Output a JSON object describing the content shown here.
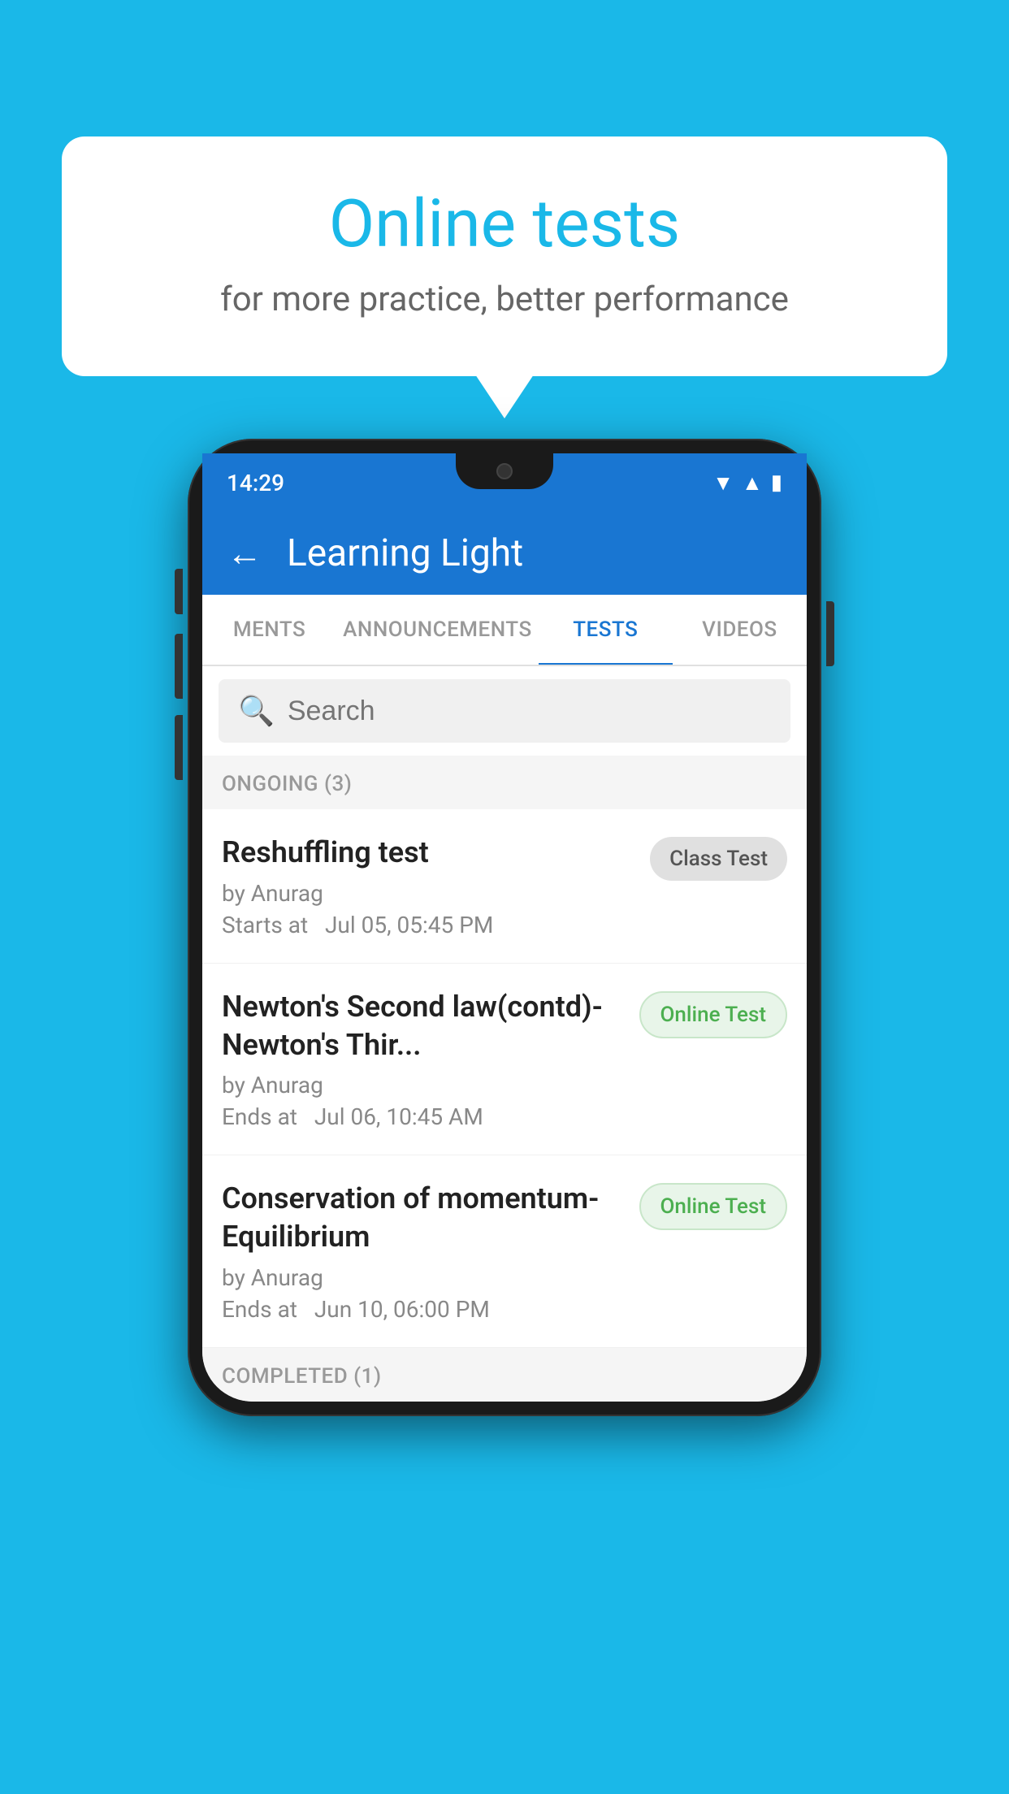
{
  "background": {
    "color": "#1ab8e8"
  },
  "speech_bubble": {
    "title": "Online tests",
    "subtitle": "for more practice, better performance"
  },
  "phone": {
    "status_bar": {
      "time": "14:29",
      "icons": [
        "wifi",
        "signal",
        "battery"
      ]
    },
    "app_header": {
      "back_label": "←",
      "title": "Learning Light"
    },
    "tabs": [
      {
        "label": "MENTS",
        "active": false
      },
      {
        "label": "ANNOUNCEMENTS",
        "active": false
      },
      {
        "label": "TESTS",
        "active": true
      },
      {
        "label": "VIDEOS",
        "active": false
      }
    ],
    "search": {
      "placeholder": "Search"
    },
    "ongoing_section": {
      "header": "ONGOING (3)",
      "items": [
        {
          "name": "Reshuffling test",
          "author": "by Anurag",
          "time_label": "Starts at",
          "time": "Jul 05, 05:45 PM",
          "badge": "Class Test",
          "badge_type": "class"
        },
        {
          "name": "Newton's Second law(contd)-Newton's Thir...",
          "author": "by Anurag",
          "time_label": "Ends at",
          "time": "Jul 06, 10:45 AM",
          "badge": "Online Test",
          "badge_type": "online"
        },
        {
          "name": "Conservation of momentum-Equilibrium",
          "author": "by Anurag",
          "time_label": "Ends at",
          "time": "Jun 10, 06:00 PM",
          "badge": "Online Test",
          "badge_type": "online"
        }
      ]
    },
    "completed_section": {
      "header": "COMPLETED (1)"
    }
  }
}
